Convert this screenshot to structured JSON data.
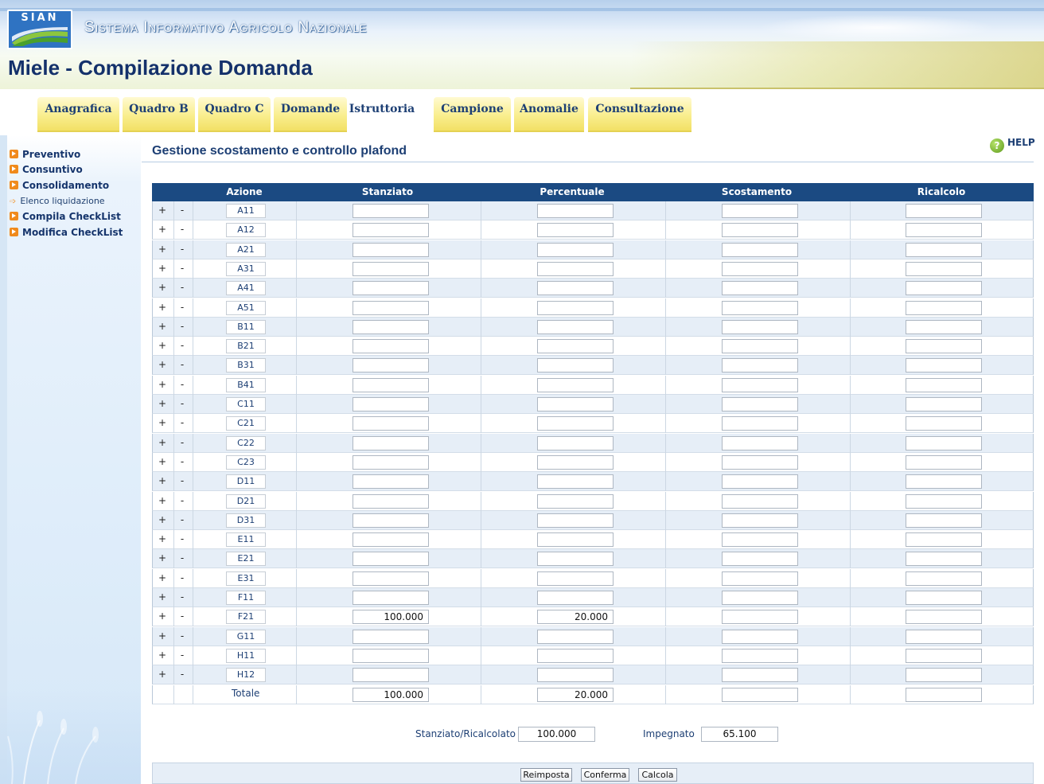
{
  "header": {
    "logo_text": "SIAN",
    "system_title": "Sistema Informativo Agricolo Nazionale",
    "page_title": "Miele - Compilazione Domanda"
  },
  "tabs": [
    {
      "label": "Anagrafica",
      "active": false
    },
    {
      "label": "Quadro B",
      "active": false
    },
    {
      "label": "Quadro C",
      "active": false
    },
    {
      "label": "Domande",
      "active": false
    },
    {
      "label": "Istruttoria",
      "active": true
    },
    {
      "label": "Campione",
      "active": false
    },
    {
      "label": "Anomalie",
      "active": false
    },
    {
      "label": "Consultazione",
      "active": false
    }
  ],
  "sidebar": {
    "items": [
      {
        "label": "Preventivo",
        "type": "main"
      },
      {
        "label": "Consuntivo",
        "type": "main"
      },
      {
        "label": "Consolidamento",
        "type": "main"
      },
      {
        "label": "Elenco liquidazione",
        "type": "sub"
      },
      {
        "label": "Compila CheckList",
        "type": "main"
      },
      {
        "label": "Modifica CheckList",
        "type": "main"
      }
    ]
  },
  "help_label": "HELP",
  "section_title": "Gestione scostamento e controllo plafond",
  "table": {
    "columns": [
      "Azione",
      "Stanziato",
      "Percentuale",
      "Scostamento",
      "Ricalcolo"
    ],
    "plus": "+",
    "minus": "-",
    "rows": [
      {
        "code": "A11",
        "stanziato": "",
        "percentuale": "",
        "scostamento": "",
        "ricalcolo": ""
      },
      {
        "code": "A12",
        "stanziato": "",
        "percentuale": "",
        "scostamento": "",
        "ricalcolo": ""
      },
      {
        "code": "A21",
        "stanziato": "",
        "percentuale": "",
        "scostamento": "",
        "ricalcolo": ""
      },
      {
        "code": "A31",
        "stanziato": "",
        "percentuale": "",
        "scostamento": "",
        "ricalcolo": ""
      },
      {
        "code": "A41",
        "stanziato": "",
        "percentuale": "",
        "scostamento": "",
        "ricalcolo": ""
      },
      {
        "code": "A51",
        "stanziato": "",
        "percentuale": "",
        "scostamento": "",
        "ricalcolo": ""
      },
      {
        "code": "B11",
        "stanziato": "",
        "percentuale": "",
        "scostamento": "",
        "ricalcolo": ""
      },
      {
        "code": "B21",
        "stanziato": "",
        "percentuale": "",
        "scostamento": "",
        "ricalcolo": ""
      },
      {
        "code": "B31",
        "stanziato": "",
        "percentuale": "",
        "scostamento": "",
        "ricalcolo": ""
      },
      {
        "code": "B41",
        "stanziato": "",
        "percentuale": "",
        "scostamento": "",
        "ricalcolo": ""
      },
      {
        "code": "C11",
        "stanziato": "",
        "percentuale": "",
        "scostamento": "",
        "ricalcolo": ""
      },
      {
        "code": "C21",
        "stanziato": "",
        "percentuale": "",
        "scostamento": "",
        "ricalcolo": ""
      },
      {
        "code": "C22",
        "stanziato": "",
        "percentuale": "",
        "scostamento": "",
        "ricalcolo": ""
      },
      {
        "code": "C23",
        "stanziato": "",
        "percentuale": "",
        "scostamento": "",
        "ricalcolo": ""
      },
      {
        "code": "D11",
        "stanziato": "",
        "percentuale": "",
        "scostamento": "",
        "ricalcolo": ""
      },
      {
        "code": "D21",
        "stanziato": "",
        "percentuale": "",
        "scostamento": "",
        "ricalcolo": ""
      },
      {
        "code": "D31",
        "stanziato": "",
        "percentuale": "",
        "scostamento": "",
        "ricalcolo": ""
      },
      {
        "code": "E11",
        "stanziato": "",
        "percentuale": "",
        "scostamento": "",
        "ricalcolo": ""
      },
      {
        "code": "E21",
        "stanziato": "",
        "percentuale": "",
        "scostamento": "",
        "ricalcolo": ""
      },
      {
        "code": "E31",
        "stanziato": "",
        "percentuale": "",
        "scostamento": "",
        "ricalcolo": ""
      },
      {
        "code": "F11",
        "stanziato": "",
        "percentuale": "",
        "scostamento": "",
        "ricalcolo": ""
      },
      {
        "code": "F21",
        "stanziato": "100.000",
        "percentuale": "20.000",
        "scostamento": "",
        "ricalcolo": ""
      },
      {
        "code": "G11",
        "stanziato": "",
        "percentuale": "",
        "scostamento": "",
        "ricalcolo": ""
      },
      {
        "code": "H11",
        "stanziato": "",
        "percentuale": "",
        "scostamento": "",
        "ricalcolo": ""
      },
      {
        "code": "H12",
        "stanziato": "",
        "percentuale": "",
        "scostamento": "",
        "ricalcolo": ""
      }
    ],
    "totals": {
      "label": "Totale",
      "stanziato": "100.000",
      "percentuale": "20.000",
      "scostamento": "",
      "ricalcolo": ""
    }
  },
  "summary": {
    "stanziato_label": "Stanziato/Ricalcolato",
    "stanziato_value": "100.000",
    "impegnato_label": "Impegnato",
    "impegnato_value": "65.100"
  },
  "buttons": {
    "reimposta": "Reimposta",
    "conferma": "Conferma",
    "calcola": "Calcola"
  },
  "colors": {
    "header_blue": "#1b4a82",
    "tab_yellow": "#f9ee8e",
    "sidebar_bullet": "#f08a1c",
    "row_alt": "#e6eef7"
  }
}
